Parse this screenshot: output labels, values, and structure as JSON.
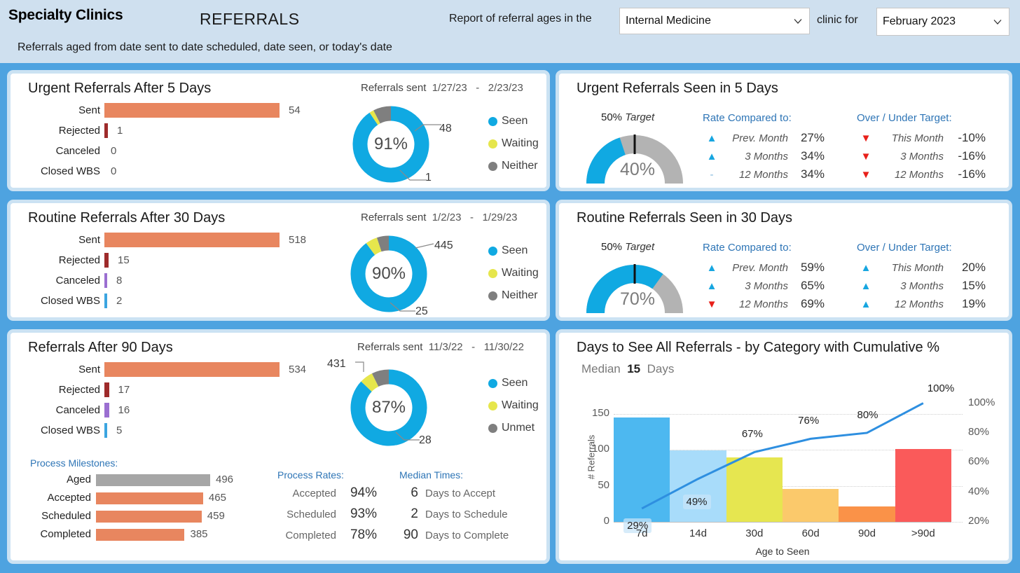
{
  "header": {
    "org": "Specialty Clinics",
    "title": "REFERRALS",
    "subtitle": "Referrals aged from date sent to date scheduled, date seen, or today's date",
    "lead_text": "Report of referral ages in the",
    "mid_text": "clinic for",
    "clinic_value": "Internal Medicine",
    "period_value": "February 2023"
  },
  "colors": {
    "page_bg": "#4ea3e0",
    "header_bg": "#cfe0ef",
    "card_border": "#cbe2f3",
    "accent_blue": "#2e75b6",
    "sent_orange": "#e8865f",
    "rejected_red": "#9e2b2b",
    "canceled_purple": "#9b6fd1",
    "closed_blue": "#3ca5e0",
    "aged_gray": "#a6a6a6",
    "seen_blue": "#10a9e2",
    "waiting_yellow": "#e6e64c",
    "neither_gray": "#7f7f7f",
    "up_color": "#17a6e0",
    "down_color": "#e8201a",
    "gauge_track": "#b3b3b3"
  },
  "urgent": {
    "title": "Urgent Referrals After 5 Days",
    "stats": [
      {
        "label": "Sent",
        "value": "54",
        "bar_pct": 100,
        "color": "#e8865f"
      },
      {
        "label": "Rejected",
        "value": "1",
        "bar_pct": 2,
        "color": "#9e2b2b"
      },
      {
        "label": "Canceled",
        "value": "0",
        "bar_pct": 0,
        "color": "#9b6fd1"
      },
      {
        "label": "Closed WBS",
        "value": "0",
        "bar_pct": 0,
        "color": "#3ca5e0"
      }
    ],
    "sent_label": "Referrals sent",
    "date_from": "1/27/23",
    "date_dash": "-",
    "date_to": "2/23/23",
    "donut": {
      "center": "91%",
      "seen": 48,
      "waiting": 1,
      "neither": 4,
      "callout_top": "48",
      "callout_bottom": "1"
    },
    "legend": [
      {
        "label": "Seen",
        "color": "#10a9e2"
      },
      {
        "label": "Waiting",
        "color": "#e6e64c"
      },
      {
        "label": "Neither",
        "color": "#7f7f7f"
      }
    ]
  },
  "urgent_seen": {
    "title": "Urgent Referrals Seen in 5 Days",
    "target_pct": "50%",
    "target_word": "Target",
    "gauge_value": "40%",
    "gauge_fill": 40,
    "target_mark": 50,
    "rate_header": "Rate Compared to:",
    "rates": [
      {
        "dir": "up",
        "name": "Prev. Month",
        "value": "27%"
      },
      {
        "dir": "up",
        "name": "3 Months",
        "value": "34%"
      },
      {
        "dir": "flat",
        "name": "12 Months",
        "value": "34%"
      }
    ],
    "target_header": "Over / Under Target:",
    "targets": [
      {
        "dir": "down",
        "name": "This Month",
        "value": "-10%"
      },
      {
        "dir": "down",
        "name": "3 Months",
        "value": "-16%"
      },
      {
        "dir": "down",
        "name": "12 Months",
        "value": "-16%"
      }
    ]
  },
  "routine": {
    "title": "Routine Referrals After 30 Days",
    "stats": [
      {
        "label": "Sent",
        "value": "518",
        "bar_pct": 100,
        "color": "#e8865f"
      },
      {
        "label": "Rejected",
        "value": "15",
        "bar_pct": 2.4,
        "color": "#9e2b2b"
      },
      {
        "label": "Canceled",
        "value": "8",
        "bar_pct": 1.4,
        "color": "#9b6fd1"
      },
      {
        "label": "Closed WBS",
        "value": "2",
        "bar_pct": 0.9,
        "color": "#3ca5e0"
      }
    ],
    "sent_label": "Referrals sent",
    "date_from": "1/2/23",
    "date_dash": "-",
    "date_to": "1/29/23",
    "donut": {
      "center": "90%",
      "seen": 445,
      "waiting": 25,
      "neither": 25,
      "callout_top": "445",
      "callout_bottom": "25"
    },
    "legend": [
      {
        "label": "Seen",
        "color": "#10a9e2"
      },
      {
        "label": "Waiting",
        "color": "#e6e64c"
      },
      {
        "label": "Neither",
        "color": "#7f7f7f"
      }
    ]
  },
  "routine_seen": {
    "title": "Routine Referrals Seen in 30 Days",
    "target_pct": "50%",
    "target_word": "Target",
    "gauge_value": "70%",
    "gauge_fill": 70,
    "target_mark": 50,
    "rate_header": "Rate Compared to:",
    "rates": [
      {
        "dir": "up",
        "name": "Prev. Month",
        "value": "59%"
      },
      {
        "dir": "up",
        "name": "3 Months",
        "value": "65%"
      },
      {
        "dir": "down",
        "name": "12 Months",
        "value": "69%"
      }
    ],
    "target_header": "Over / Under Target:",
    "targets": [
      {
        "dir": "up",
        "name": "This Month",
        "value": "20%"
      },
      {
        "dir": "up",
        "name": "3 Months",
        "value": "15%"
      },
      {
        "dir": "up",
        "name": "12 Months",
        "value": "19%"
      }
    ]
  },
  "days90": {
    "title": "Referrals After 90 Days",
    "stats": [
      {
        "label": "Sent",
        "value": "534",
        "bar_pct": 100,
        "color": "#e8865f"
      },
      {
        "label": "Rejected",
        "value": "17",
        "bar_pct": 2.6,
        "color": "#9e2b2b"
      },
      {
        "label": "Canceled",
        "value": "16",
        "bar_pct": 2.6,
        "color": "#9b6fd1"
      },
      {
        "label": "Closed WBS",
        "value": "5",
        "bar_pct": 1.2,
        "color": "#3ca5e0"
      }
    ],
    "sent_label": "Referrals sent",
    "date_from": "11/3/22",
    "date_dash": "-",
    "date_to": "11/30/22",
    "donut": {
      "center": "87%",
      "seen": 431,
      "waiting": 28,
      "neither": 36,
      "callout_top": "431",
      "callout_bottom": "28"
    },
    "legend": [
      {
        "label": "Seen",
        "color": "#10a9e2"
      },
      {
        "label": "Waiting",
        "color": "#e6e64c"
      },
      {
        "label": "Unmet",
        "color": "#7f7f7f"
      }
    ],
    "milestones_header": "Process Milestones:",
    "milestones": [
      {
        "label": "Aged",
        "value": "496",
        "bar_pct": 100,
        "color": "#a6a6a6"
      },
      {
        "label": "Accepted",
        "value": "465",
        "bar_pct": 93.8,
        "color": "#e8865f"
      },
      {
        "label": "Scheduled",
        "value": "459",
        "bar_pct": 92.5,
        "color": "#e8865f"
      },
      {
        "label": "Completed",
        "value": "385",
        "bar_pct": 77.6,
        "color": "#e8865f"
      }
    ],
    "rates_header": "Process Rates:",
    "rates": [
      {
        "label": "Accepted",
        "value": "94%"
      },
      {
        "label": "Scheduled",
        "value": "93%"
      },
      {
        "label": "Completed",
        "value": "78%"
      }
    ],
    "times_header": "Median Times:",
    "times": [
      {
        "value": "6",
        "label": "Days to Accept"
      },
      {
        "value": "2",
        "label": "Days to Schedule"
      },
      {
        "value": "90",
        "label": "Days to Complete"
      }
    ]
  },
  "chart_data": {
    "type": "bar",
    "title": "Days to See All Referrals - by Category with Cumulative %",
    "median_prefix": "Median",
    "median_value": "15",
    "median_suffix": "Days",
    "categories": [
      "7d",
      "14d",
      "30d",
      "60d",
      "90d",
      ">90d"
    ],
    "values": [
      145,
      99,
      89,
      46,
      21,
      101
    ],
    "bar_colors": [
      "#4db8f0",
      "#a8dcfa",
      "#e6e650",
      "#fbc96b",
      "#fa9248",
      "#fa5a5a"
    ],
    "series": [
      {
        "name": "# Referrals",
        "type": "bar",
        "values": [
          145,
          99,
          89,
          46,
          21,
          101
        ]
      },
      {
        "name": "Cumulative %",
        "type": "line",
        "values": [
          29,
          49,
          67,
          76,
          80,
          100
        ],
        "color": "#2e8fe0"
      }
    ],
    "cumulative_labels": [
      "29%",
      "49%",
      "67%",
      "76%",
      "80%",
      "100%"
    ],
    "xlabel": "Age to Seen",
    "ylabel": "# Referrals",
    "y2label": "Cumulative %",
    "yticks": [
      "0",
      "50",
      "100",
      "150"
    ],
    "ylim": [
      0,
      175
    ],
    "y2ticks": [
      "20%",
      "40%",
      "60%",
      "80%",
      "100%"
    ],
    "y2lim": [
      20,
      105
    ],
    "grid": true,
    "legend_position": "none"
  }
}
